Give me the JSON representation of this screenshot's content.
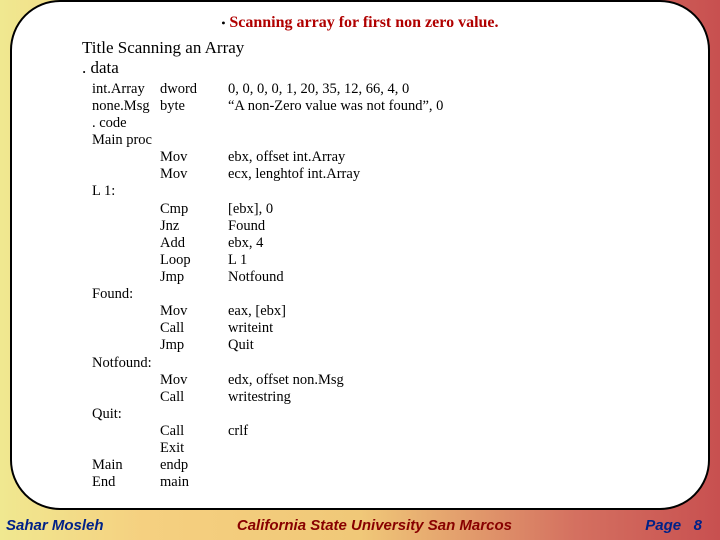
{
  "heading": "Scanning array for first non zero value.",
  "title1": "Title Scanning an Array",
  "title2": ". data",
  "rows": [
    {
      "c1": "int.Array",
      "c2": "dword",
      "c3": "0, 0, 0, 0, 1, 20, 35, 12, 66, 4, 0"
    },
    {
      "c1": "none.Msg",
      "c2": "byte",
      "c3": "“A non-Zero value was not found”, 0"
    },
    {
      "c1": ". code",
      "c2": "",
      "c3": ""
    },
    {
      "c1": "Main  proc",
      "c2": "",
      "c3": ""
    },
    {
      "c1": "",
      "c2": "Mov",
      "c3": "ebx, offset int.Array"
    },
    {
      "c1": "",
      "c2": "Mov",
      "c3": "ecx, lenghtof int.Array"
    },
    {
      "c1": "L 1:",
      "c2": "",
      "c3": ""
    },
    {
      "c1": "",
      "c2": "Cmp",
      "c3": "[ebx], 0"
    },
    {
      "c1": "",
      "c2": "Jnz",
      "c3": "Found"
    },
    {
      "c1": "",
      "c2": "Add",
      "c3": "ebx, 4"
    },
    {
      "c1": "",
      "c2": "Loop",
      "c3": "L 1"
    },
    {
      "c1": "",
      "c2": "Jmp",
      "c3": "Notfound"
    },
    {
      "c1": "Found:",
      "c2": "",
      "c3": ""
    },
    {
      "c1": "",
      "c2": "Mov",
      "c3": "eax, [ebx]"
    },
    {
      "c1": "",
      "c2": "Call",
      "c3": "writeint"
    },
    {
      "c1": "",
      "c2": "Jmp",
      "c3": "Quit"
    },
    {
      "c1": "Notfound:",
      "c2": "",
      "c3": ""
    },
    {
      "c1": "",
      "c2": "Mov",
      "c3": "edx, offset non.Msg"
    },
    {
      "c1": "",
      "c2": "Call",
      "c3": "writestring"
    },
    {
      "c1": "Quit:",
      "c2": "",
      "c3": ""
    },
    {
      "c1": "",
      "c2": "Call",
      "c3": "crlf"
    },
    {
      "c1": "",
      "c2": "Exit",
      "c3": ""
    },
    {
      "c1": "Main",
      "c2": "endp",
      "c3": ""
    },
    {
      "c1": "End",
      "c2": "main",
      "c3": ""
    }
  ],
  "footer": {
    "author": "Sahar Mosleh",
    "university": "California State University San Marcos",
    "page_label": "Page   8"
  }
}
